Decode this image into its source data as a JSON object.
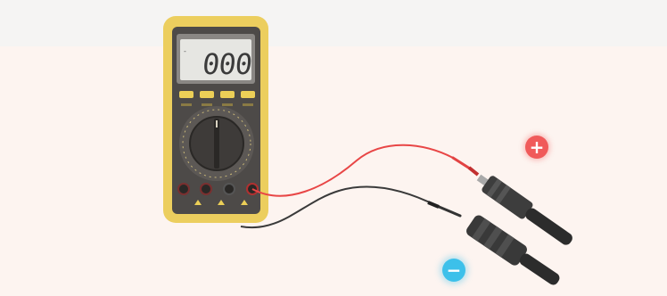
{
  "multimeter": {
    "display_reading": "000"
  },
  "polarity": {
    "positive_symbol": "+",
    "negative_symbol": "−",
    "positive_color": "#f05a5a",
    "negative_color": "#3cc0ea"
  },
  "colors": {
    "meter_body": "#ecce5e",
    "meter_face": "#4d4a48",
    "red_lead": "#e84646",
    "black_lead": "#3a3a3a"
  },
  "icons": [
    "multimeter-icon",
    "rotary-dial-icon",
    "test-probe-icon",
    "solar-connector-icon"
  ]
}
